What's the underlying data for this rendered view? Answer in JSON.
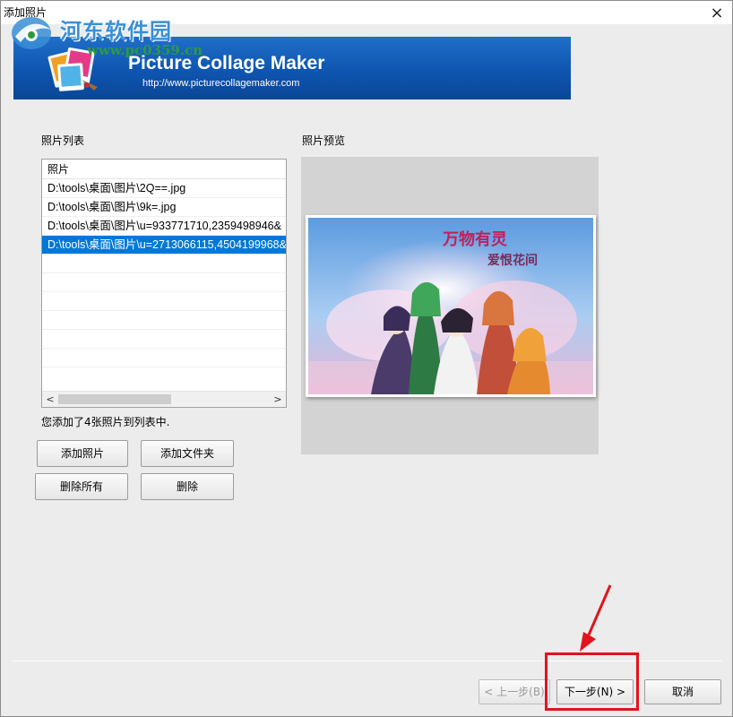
{
  "window": {
    "title": "添加照片",
    "close_glyph": "×"
  },
  "watermark": {
    "name": "河东软件园",
    "url": "www.pc0359.cn"
  },
  "banner": {
    "title": "Picture Collage Maker",
    "url": "http://www.picturecollagemaker.com"
  },
  "photo_list": {
    "label": "照片列表",
    "column_header": "照片",
    "items": [
      "D:\\tools\\桌面\\图片\\2Q==.jpg",
      "D:\\tools\\桌面\\图片\\9k=.jpg",
      "D:\\tools\\桌面\\图片\\u=933771710,2359498946&",
      "D:\\tools\\桌面\\图片\\u=2713066115,4504199968&"
    ],
    "selected_index": 3,
    "status": "您添加了4张照片到列表中."
  },
  "preview": {
    "label": "照片预览",
    "image_text_1": "万物有灵",
    "image_text_2": "爱恨花间"
  },
  "buttons": {
    "add_photo": "添加照片",
    "add_folder": "添加文件夹",
    "delete_all": "删除所有",
    "delete": "删除",
    "prev": "< 上一步(B)",
    "next": "下一步(N) >",
    "cancel": "取消"
  },
  "colors": {
    "selection": "#0078d7",
    "banner": "#0e55b0",
    "annotation": "#e0141c"
  }
}
